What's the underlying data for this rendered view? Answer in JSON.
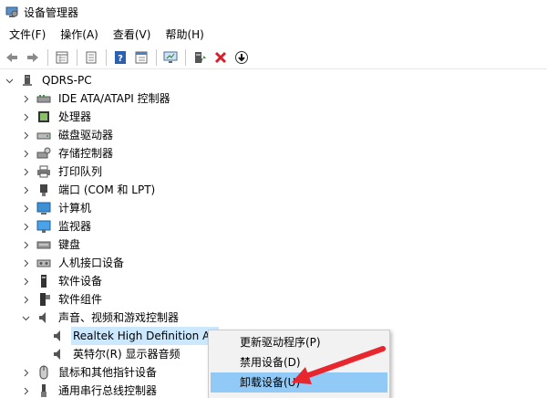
{
  "window": {
    "title": "设备管理器"
  },
  "menu": [
    {
      "label": "文件(F)"
    },
    {
      "label": "操作(A)"
    },
    {
      "label": "查看(V)"
    },
    {
      "label": "帮助(H)"
    }
  ],
  "toolbar": {
    "icons": [
      "back-arrow-icon",
      "forward-arrow-icon",
      "properties-grid-icon",
      "device-list-icon",
      "help-icon",
      "resource-view-icon",
      "monitor-scan-icon",
      "update-driver-icon",
      "uninstall-x-icon",
      "download-arrow-icon"
    ]
  },
  "tree": {
    "root": "QDRS-PC",
    "categories": [
      {
        "label": "IDE ATA/ATAPI 控制器",
        "icon": "ide-controller-icon"
      },
      {
        "label": "处理器",
        "icon": "processor-icon"
      },
      {
        "label": "磁盘驱动器",
        "icon": "disk-drive-icon"
      },
      {
        "label": "存储控制器",
        "icon": "storage-controller-icon"
      },
      {
        "label": "打印队列",
        "icon": "printer-icon"
      },
      {
        "label": "端口 (COM 和 LPT)",
        "icon": "port-icon"
      },
      {
        "label": "计算机",
        "icon": "computer-icon"
      },
      {
        "label": "监视器",
        "icon": "monitor-icon"
      },
      {
        "label": "键盘",
        "icon": "keyboard-icon"
      },
      {
        "label": "人机接口设备",
        "icon": "hid-icon"
      },
      {
        "label": "软件设备",
        "icon": "software-device-icon"
      },
      {
        "label": "软件组件",
        "icon": "software-component-icon"
      },
      {
        "label": "声音、视频和游戏控制器",
        "icon": "speaker-icon"
      }
    ],
    "sound_children": [
      {
        "label": "Realtek High Definition Au",
        "icon": "speaker-icon"
      },
      {
        "label": "英特尔(R) 显示器音频",
        "icon": "speaker-icon"
      }
    ],
    "after": [
      {
        "label": "鼠标和其他指针设备",
        "icon": "mouse-icon"
      },
      {
        "label": "通用串行总线控制器",
        "icon": "usb-icon"
      }
    ]
  },
  "context_menu": {
    "items": [
      {
        "label": "更新驱动程序(P)"
      },
      {
        "label": "禁用设备(D)"
      },
      {
        "label": "卸载设备(U)"
      }
    ],
    "highlighted_index": 2
  },
  "colors": {
    "selection": "#cce8ff",
    "menu_hover": "#91c9f7",
    "arrow": "#e8262e"
  }
}
